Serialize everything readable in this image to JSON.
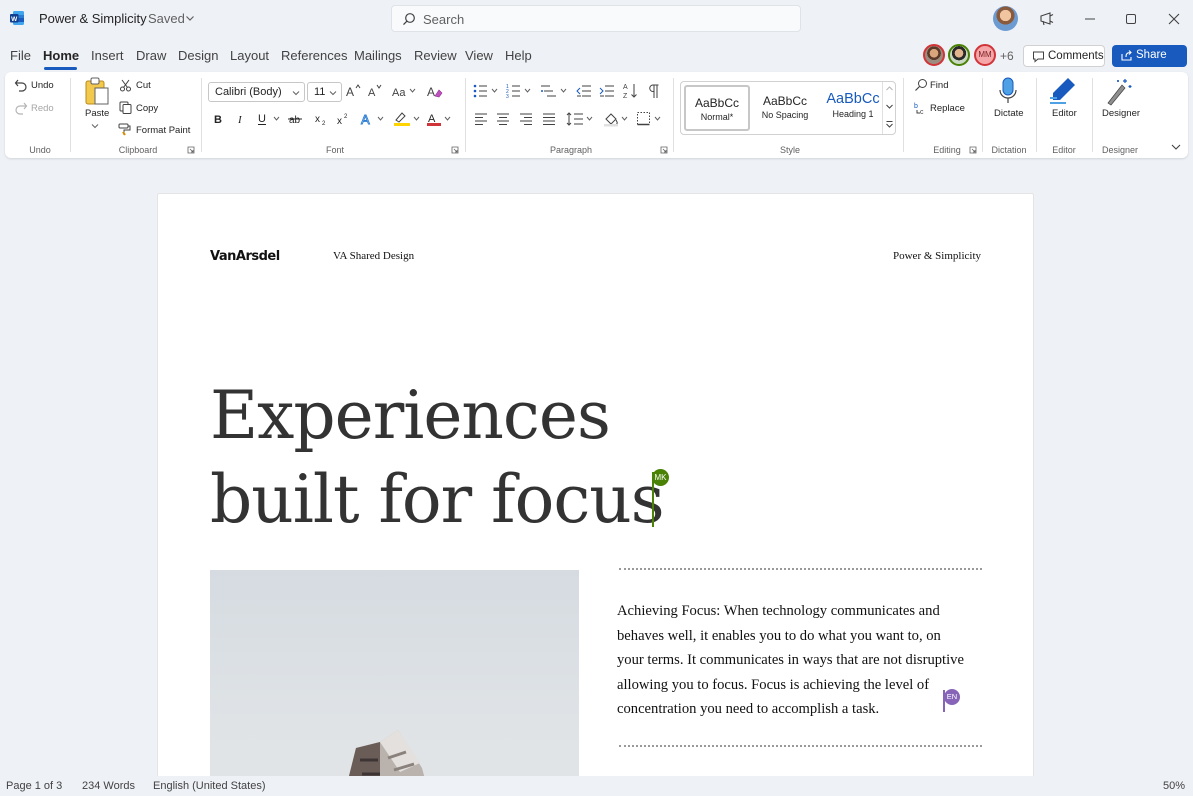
{
  "titlebar": {
    "app_title": "Power & Simplicity",
    "saved_status": "Saved",
    "search_placeholder": "Search"
  },
  "menu_tabs": [
    "File",
    "Home",
    "Insert",
    "Draw",
    "Design",
    "Layout",
    "References",
    "Mailings",
    "Review",
    "View",
    "Help"
  ],
  "active_tab": "Home",
  "collaborators": {
    "initials": "MM",
    "more_count": "+6"
  },
  "buttons": {
    "comments": "Comments",
    "share": "Share"
  },
  "ribbon": {
    "undo": {
      "undo": "Undo",
      "redo": "Redo",
      "group": "Undo"
    },
    "clipboard": {
      "paste": "Paste",
      "cut": "Cut",
      "copy": "Copy",
      "format_paint": "Format Paint",
      "group": "Clipboard"
    },
    "font": {
      "family": "Calibri (Body)",
      "size": "11",
      "group": "Font"
    },
    "paragraph": {
      "group": "Paragraph"
    },
    "styles": {
      "items": [
        {
          "sample": "AaBbCc",
          "name": "Normal*"
        },
        {
          "sample": "AaBbCc",
          "name": "No Spacing"
        },
        {
          "sample": "AaBbCc",
          "name": "Heading 1"
        }
      ],
      "group": "Style"
    },
    "editing": {
      "find": "Find",
      "replace": "Replace",
      "group": "Editing"
    },
    "dictation": {
      "dictate": "Dictate",
      "group": "Dictation"
    },
    "editor": {
      "editor": "Editor",
      "group": "Editor"
    },
    "designer": {
      "designer": "Designer",
      "group": "Designer"
    }
  },
  "document": {
    "brand": "VanArsdel",
    "header_mid": "VA Shared Design",
    "header_right": "Power & Simplicity",
    "heading_line1": "Experiences",
    "heading_line2": "built for focus",
    "cursor_mk": "MK",
    "cursor_en": "EN",
    "body_text": "Achieving Focus: When technology communicates and behaves well, it enables you to do what you want to, on your terms. It communicates in ways that are not disruptive allowing you to focus. Focus is achieving the level of concentration you need to accomplish a task."
  },
  "statusbar": {
    "page": "Page 1 of 3",
    "words": "234 Words",
    "language": "English (United States)",
    "zoom": "50%"
  },
  "colors": {
    "accent": "#185abd",
    "mk_cursor": "#498205",
    "en_cursor": "#8764b8",
    "font_color_underline": "#d13438",
    "highlight": "#ffd400"
  }
}
